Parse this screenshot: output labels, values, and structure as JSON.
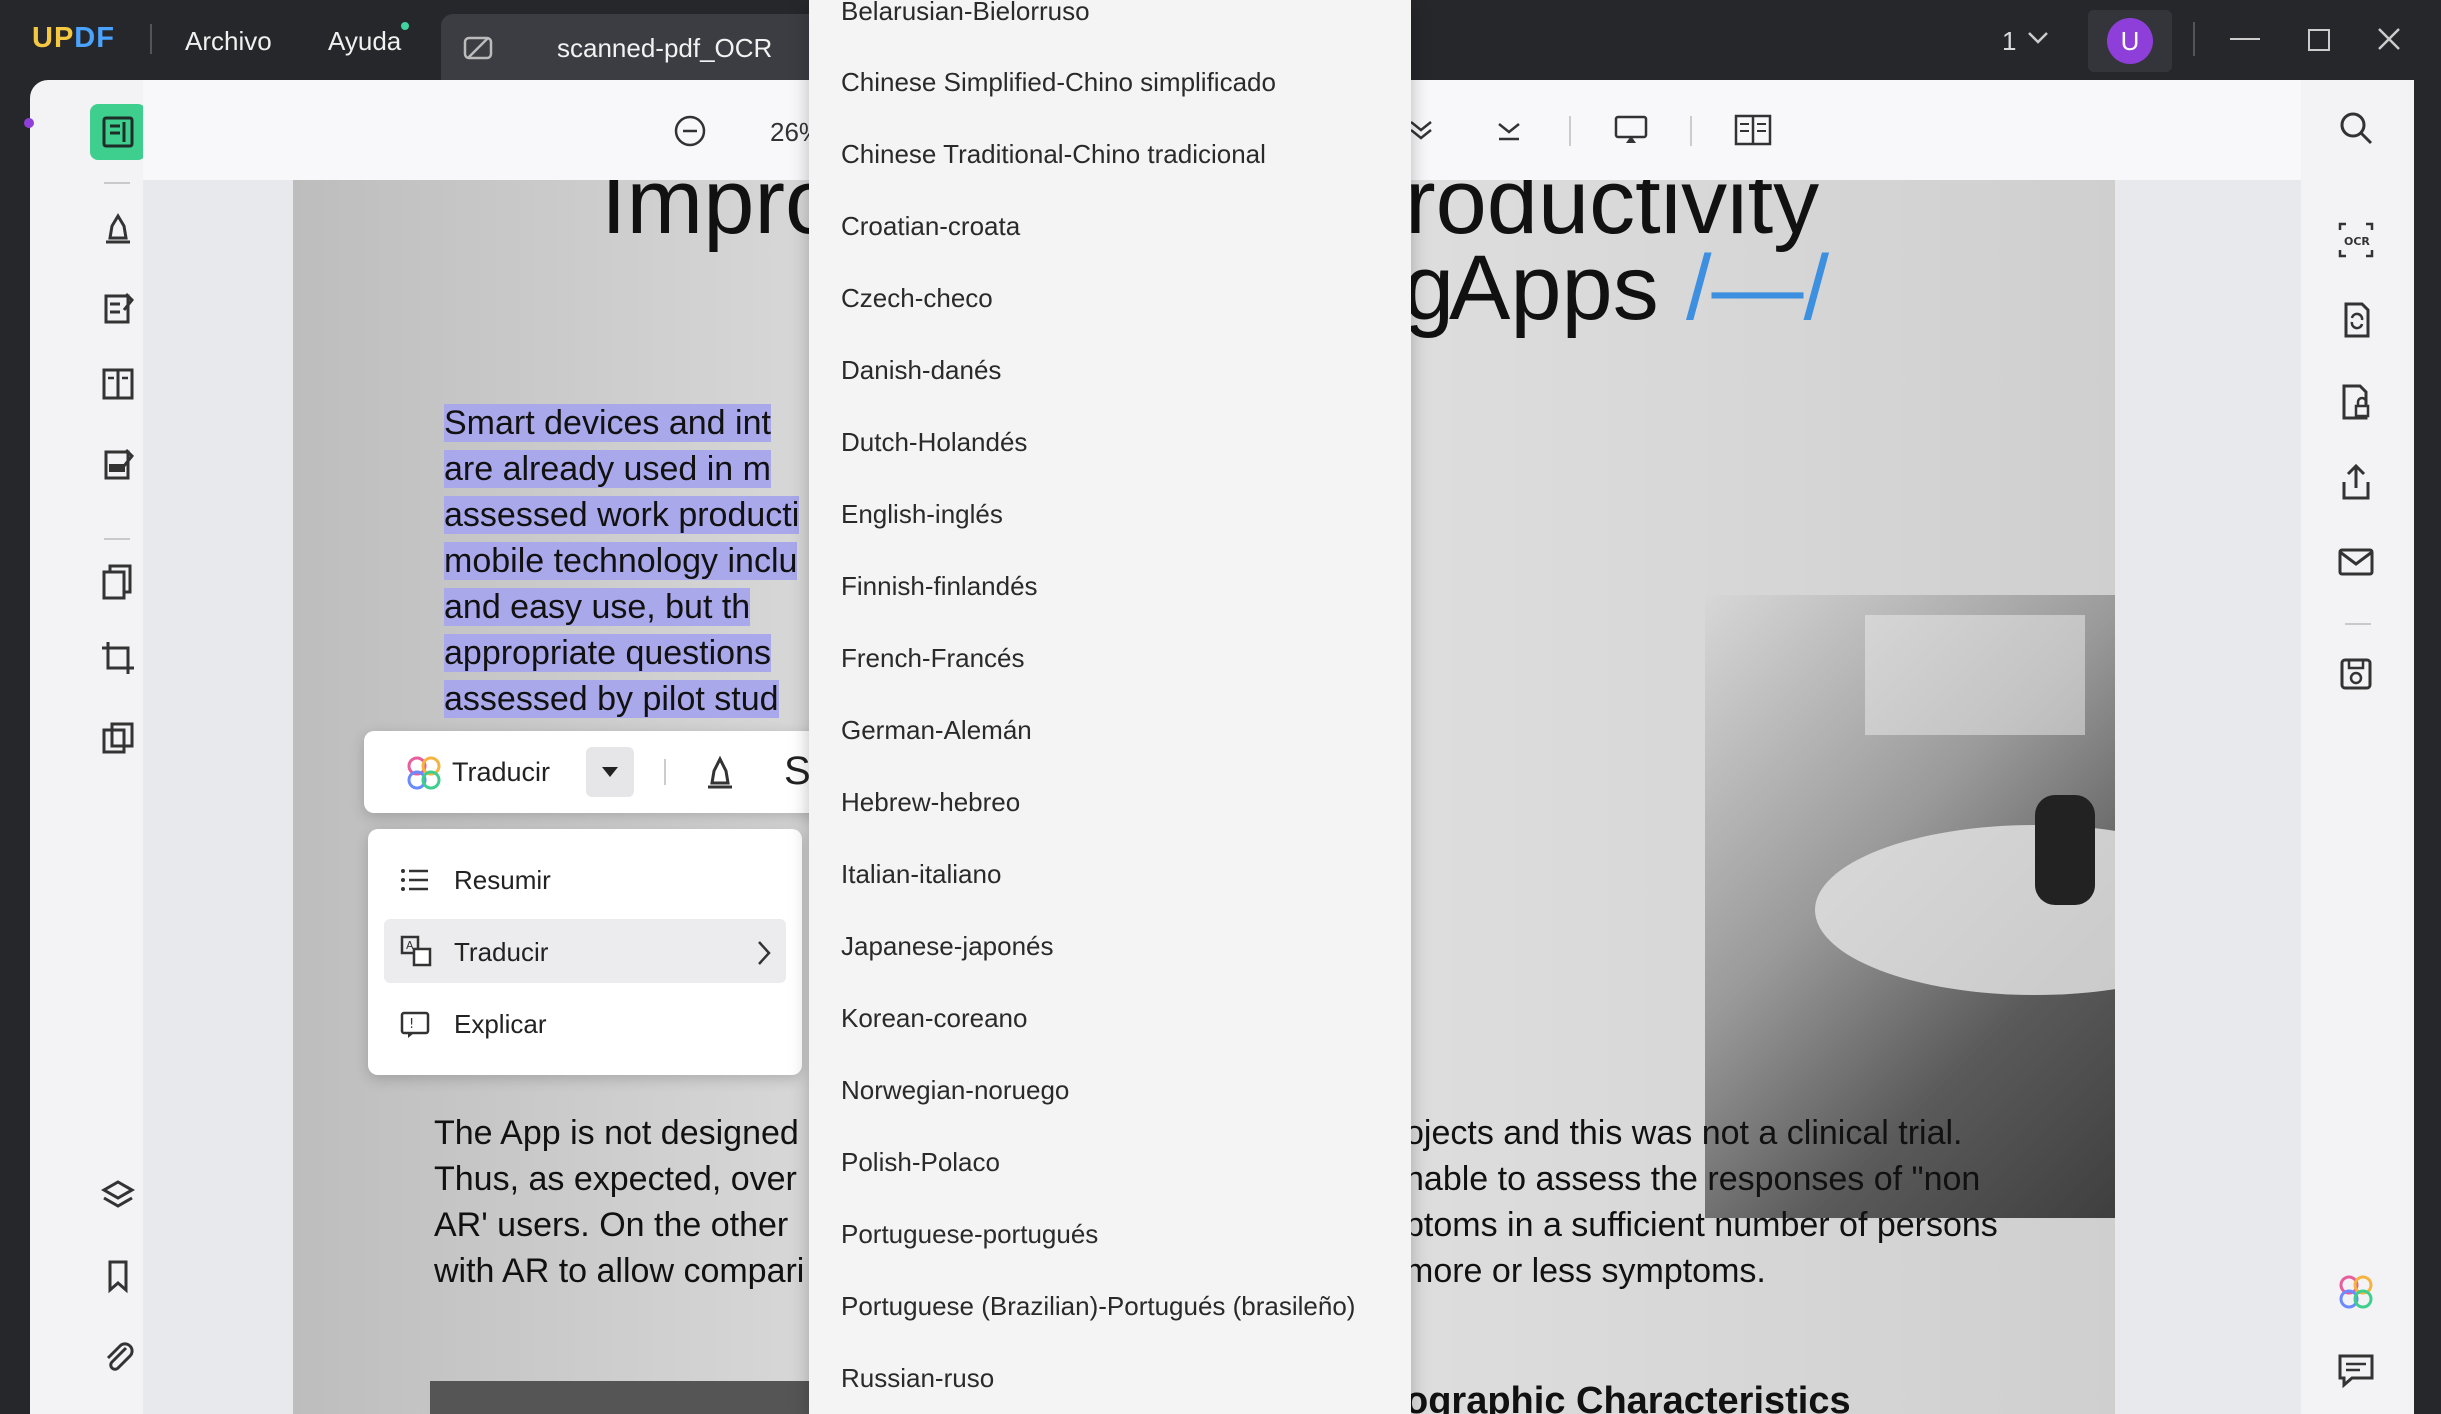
{
  "app": {
    "logo": "UPDF",
    "logo_first": "UP",
    "logo_second": "DF"
  },
  "menu": {
    "archivo": "Archivo",
    "ayuda": "Ayuda"
  },
  "tab": {
    "title": "scanned-pdf_OCR"
  },
  "titlebar": {
    "page_indicator": "1",
    "avatar_letter": "U"
  },
  "toolbar": {
    "zoom": "26%"
  },
  "document": {
    "title_line1_left": "Impro",
    "title_line1_right": "roductivity",
    "title_line2_left": "g",
    "title_line2_right": "Apps",
    "title_mark": "/—/",
    "highlight_lines": [
      "Smart devices and int",
      "are already used in m",
      "assessed work producti",
      "mobile technology inclu",
      "and easy use, but th",
      "appropriate questions",
      "assessed by pilot stud"
    ],
    "left_para": [
      "The App is not designed",
      "Thus, as expected, over",
      "AR' users. On the other",
      "with AR to allow compari"
    ],
    "right_para": [
      "ojects and this was not a clinical trial.",
      "nable to assess the responses of \"non",
      "ptoms in a sufficient number of persons",
      "more or less symptoms."
    ],
    "bottom_heading": "ographic Characteristics"
  },
  "ai_toolbar": {
    "translate_label": "Traducir"
  },
  "ai_menu": {
    "items": [
      "Resumir",
      "Traducir",
      "Explicar"
    ]
  },
  "languages": [
    "Belarusian-Bielorruso",
    "Chinese Simplified-Chino simplificado",
    "Chinese Traditional-Chino tradicional",
    "Croatian-croata",
    "Czech-checo",
    "Danish-danés",
    "Dutch-Holandés",
    "English-inglés",
    "Finnish-finlandés",
    "French-Francés",
    "German-Alemán",
    "Hebrew-hebreo",
    "Italian-italiano",
    "Japanese-japonés",
    "Korean-coreano",
    "Norwegian-noruego",
    "Polish-Polaco",
    "Portuguese-portugués",
    "Portuguese (Brazilian)-Portugués (brasileño)",
    "Russian-ruso"
  ],
  "colors": {
    "accent": "#3ecf8e",
    "highlight": "#a9a8ea",
    "avatar": "#8e3fd9"
  }
}
